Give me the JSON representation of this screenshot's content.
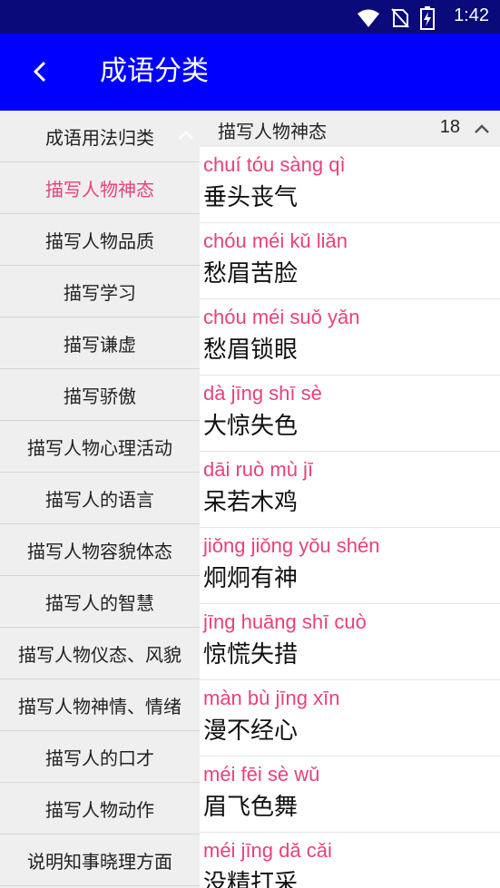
{
  "status_bar": {
    "time": "1:42"
  },
  "app_bar": {
    "title": "成语分类"
  },
  "left_panel": {
    "header": "成语用法归类",
    "categories": [
      "描写人物神态",
      "描写人物品质",
      "描写学习",
      "描写谦虚",
      "描写骄傲",
      "描写人物心理活动",
      "描写人的语言",
      "描写人物容貌体态",
      "描写人的智慧",
      "描写人物仪态、风貌",
      "描写人物神情、情绪",
      "描写人的口才",
      "描写人物动作",
      "说明知事晓理方面"
    ]
  },
  "right_panel": {
    "header_label": "描写人物神态",
    "count": "18",
    "items": [
      {
        "pinyin": "chuí tóu sàng qì",
        "word": "垂头丧气"
      },
      {
        "pinyin": "chóu méi kǔ liǎn",
        "word": "愁眉苦脸"
      },
      {
        "pinyin": "chóu méi suǒ yǎn",
        "word": "愁眉锁眼"
      },
      {
        "pinyin": "dà jīng shī sè",
        "word": "大惊失色"
      },
      {
        "pinyin": "dāi ruò mù jī",
        "word": "呆若木鸡"
      },
      {
        "pinyin": "jiǒng jiǒng yǒu shén",
        "word": "炯炯有神"
      },
      {
        "pinyin": "jīng huāng shī cuò",
        "word": "惊慌失措"
      },
      {
        "pinyin": "màn bù jīng xīn",
        "word": "漫不经心"
      },
      {
        "pinyin": "méi fēi sè wǔ",
        "word": "眉飞色舞"
      },
      {
        "pinyin": "méi jīng dǎ cǎi",
        "word": "没精打采"
      }
    ]
  },
  "colors": {
    "app_bar": "#0000ff",
    "status_bar": "#0a0a7a",
    "accent": "#e8417b"
  }
}
